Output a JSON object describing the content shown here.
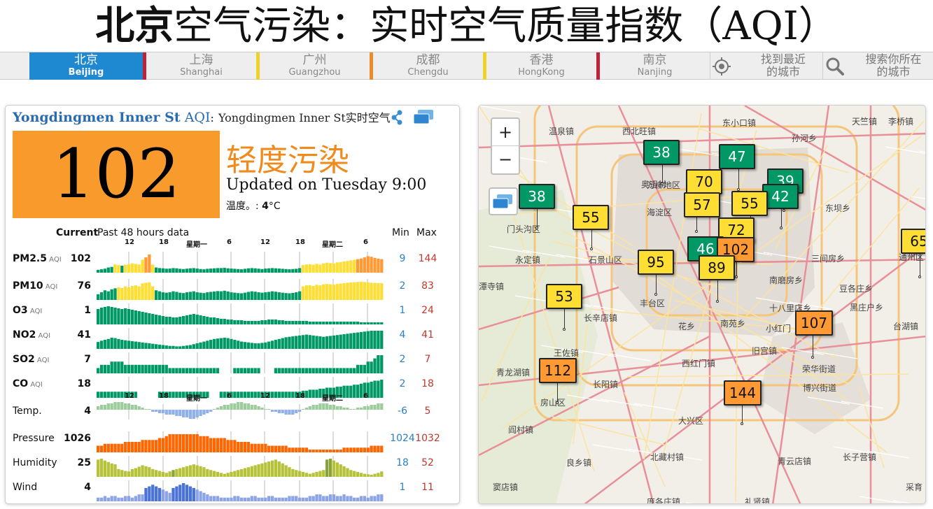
{
  "header": {
    "title_bold": "北京",
    "title_rest": "空气污染：实时空气质量指数（AQI）"
  },
  "nav": {
    "tabs": [
      {
        "zh": "北京",
        "en": "Beijing",
        "active": true
      },
      {
        "zh": "上海",
        "en": "Shanghai"
      },
      {
        "zh": "广州",
        "en": "Guangzhou"
      },
      {
        "zh": "成都",
        "en": "Chengdu"
      },
      {
        "zh": "香港",
        "en": "HongKong"
      },
      {
        "zh": "南京",
        "en": "Nanjing"
      }
    ],
    "separator_colors": [
      "#c0223b",
      "#ecd326",
      "#ec8b2c",
      "#ecd326",
      "#c0223b"
    ],
    "find_nearest_line1": "找到最近",
    "find_nearest_line2": "的城市",
    "search_line1": "搜索你所在",
    "search_line2": "的城市",
    "icons": [
      "locate-icon",
      "search-icon"
    ]
  },
  "station": {
    "name": "Yongdingmen Inner St",
    "aqi_label": "AQI",
    "colon": ":",
    "description": "Yongdingmen Inner St实时空气",
    "aqi": "102",
    "level": "轻度污染",
    "updated": "Updated on Tuesday 9:00",
    "temp_label": "温度。:",
    "temp_value": "4",
    "temp_unit": "°C",
    "aqi_color": "#f99b2c"
  },
  "table": {
    "current_header": "Current",
    "past_header": "Past 48 hours data",
    "min_header": "Min",
    "max_header": "Max",
    "time_ticks": [
      "12",
      "18",
      "星期一",
      "6",
      "12",
      "18",
      "星期二",
      "6"
    ],
    "rows": [
      {
        "name": "PM2.5",
        "sub": "AQI",
        "current": "102",
        "min": "9",
        "max": "144",
        "bold": true
      },
      {
        "name": "PM10",
        "sub": "AQI",
        "current": "76",
        "min": "2",
        "max": "83",
        "bold": true
      },
      {
        "name": "O3",
        "sub": "AQI",
        "current": "1",
        "min": "1",
        "max": "24",
        "bold": true
      },
      {
        "name": "NO2",
        "sub": "AQI",
        "current": "41",
        "min": "4",
        "max": "41",
        "bold": true
      },
      {
        "name": "SO2",
        "sub": "AQI",
        "current": "7",
        "min": "2",
        "max": "7",
        "bold": true
      },
      {
        "name": "CO",
        "sub": "AQI",
        "current": "18",
        "min": "2",
        "max": "18",
        "bold": true
      },
      {
        "name": "Temp.",
        "sub": "",
        "current": "4",
        "min": "-6",
        "max": "5",
        "bold": false
      },
      {
        "name": "Pressure",
        "sub": "",
        "current": "1026",
        "min": "1024",
        "max": "1032",
        "bold": false
      },
      {
        "name": "Humidity",
        "sub": "",
        "current": "25",
        "min": "18",
        "max": "52",
        "bold": false
      },
      {
        "name": "Wind",
        "sub": "",
        "current": "4",
        "min": "1",
        "max": "11",
        "bold": false
      }
    ]
  },
  "colors": {
    "good": "#009966",
    "moderate": "#ffde33",
    "usg": "#ff9933",
    "temp": "#8fb0e8",
    "temp_warm": "#9ccc9c",
    "pressure": "#ff6600",
    "humidity": "#b5c23a",
    "wind": "#8ba4e8",
    "nav_active": "#1e88d0"
  },
  "map": {
    "zoom_in": "+",
    "zoom_out": "−",
    "places": [
      "温泉镇",
      "西北旺镇",
      "东小口镇",
      "天竺镇",
      "李桥镇",
      "孙河乡",
      "万柳地区",
      "海淀区",
      "门头沟区",
      "东坝乡",
      "石景山区",
      "永定镇",
      "三间房乡",
      "潭寺镇",
      "丰台区",
      "南磨房乡",
      "豆各庄乡",
      "长辛店镇",
      "花乡",
      "南苑乡",
      "十八里店乡",
      "黑庄户乡",
      "台湖镇",
      "小红门",
      "旧宫镇",
      "王佐镇",
      "荣华街道",
      "青龙湖镇",
      "长阳镇",
      "西红门镇",
      "博兴街道",
      "房山区",
      "大兴区",
      "阎村镇",
      "北藏村镇",
      "青云店镇",
      "长子营镇",
      "良乡镇",
      "窦店镇",
      "庞各庄镇",
      "礼贤镇",
      "采育",
      "通州区",
      "奥运村"
    ],
    "markers": [
      {
        "v": "38",
        "c": "good"
      },
      {
        "v": "47",
        "c": "good"
      },
      {
        "v": "39",
        "c": "good"
      },
      {
        "v": "42",
        "c": "good"
      },
      {
        "v": "38",
        "c": "good"
      },
      {
        "v": "70",
        "c": "moderate"
      },
      {
        "v": "57",
        "c": "moderate"
      },
      {
        "v": "55",
        "c": "moderate"
      },
      {
        "v": "55",
        "c": "moderate"
      },
      {
        "v": "72",
        "c": "moderate"
      },
      {
        "v": "46",
        "c": "good"
      },
      {
        "v": "102",
        "c": "usg"
      },
      {
        "v": "95",
        "c": "moderate"
      },
      {
        "v": "89",
        "c": "moderate"
      },
      {
        "v": "53",
        "c": "moderate"
      },
      {
        "v": "107",
        "c": "usg"
      },
      {
        "v": "112",
        "c": "usg"
      },
      {
        "v": "144",
        "c": "usg"
      },
      {
        "v": "65",
        "c": "moderate"
      }
    ]
  },
  "chart_data": {
    "type": "bar",
    "title": "Past 48 hours data",
    "x_ticks": [
      "12",
      "18",
      "星期一",
      "6",
      "12",
      "18",
      "星期二",
      "6"
    ],
    "series": [
      {
        "name": "PM2.5",
        "values": [
          15,
          20,
          25,
          35,
          40,
          60,
          55,
          50,
          58,
          62,
          70,
          65,
          60,
          100,
          120,
          144,
          60,
          35,
          30,
          28,
          25,
          26,
          30,
          28,
          24,
          22,
          25,
          28,
          30,
          26,
          22,
          20,
          24,
          26,
          28,
          30,
          30,
          32,
          28,
          26,
          24,
          22,
          20,
          24,
          28,
          30,
          28,
          25,
          22,
          26,
          28,
          30,
          28,
          26,
          24,
          22,
          20,
          22,
          24,
          30,
          55,
          60,
          62,
          58,
          65,
          60,
          70,
          75,
          72,
          70,
          78,
          80,
          85,
          90,
          95,
          100,
          105,
          110,
          120,
          130,
          125,
          115,
          110,
          105
        ]
      },
      {
        "name": "PM10",
        "values": [
          20,
          30,
          40,
          35,
          45,
          50,
          55,
          52,
          60,
          55,
          62,
          65,
          60,
          75,
          78,
          80,
          60,
          40,
          35,
          30,
          28,
          30,
          35,
          32,
          28,
          26,
          30,
          32,
          35,
          30,
          28,
          26,
          30,
          32,
          34,
          36,
          35,
          38,
          34,
          30,
          28,
          26,
          25,
          28,
          32,
          35,
          33,
          30,
          28,
          30,
          32,
          35,
          33,
          30,
          28,
          26,
          25,
          27,
          30,
          35,
          60,
          65,
          66,
          62,
          68,
          65,
          70,
          72,
          70,
          68,
          72,
          74,
          76,
          78,
          80,
          81,
          82,
          83,
          82,
          80,
          78,
          77,
          76,
          76
        ]
      },
      {
        "name": "O3",
        "values": [
          20,
          22,
          23,
          24,
          23,
          22,
          21,
          20,
          21,
          20,
          19,
          18,
          17,
          16,
          15,
          14,
          13,
          12,
          11,
          10,
          9,
          9,
          8,
          8,
          9,
          10,
          11,
          12,
          13,
          12,
          11,
          10,
          9,
          8,
          8,
          7,
          6,
          6,
          5,
          5,
          4,
          4,
          4,
          3,
          3,
          3,
          3,
          3,
          4,
          4,
          5,
          5,
          5,
          4,
          4,
          3,
          3,
          3,
          3,
          3,
          3,
          3,
          2,
          2,
          2,
          2,
          2,
          2,
          2,
          2,
          2,
          2,
          2,
          2,
          2,
          2,
          2,
          1,
          1,
          1,
          1,
          1,
          1,
          1
        ]
      },
      {
        "name": "NO2",
        "values": [
          15,
          18,
          20,
          22,
          25,
          24,
          22,
          20,
          19,
          18,
          17,
          16,
          15,
          14,
          13,
          12,
          11,
          10,
          9,
          8,
          7,
          6,
          6,
          5,
          5,
          6,
          7,
          8,
          10,
          12,
          14,
          16,
          18,
          20,
          22,
          23,
          24,
          25,
          24,
          22,
          20,
          18,
          16,
          15,
          14,
          13,
          12,
          12,
          13,
          14,
          16,
          18,
          20,
          22,
          24,
          26,
          27,
          28,
          29,
          30,
          31,
          32,
          31,
          30,
          29,
          28,
          27,
          28,
          29,
          30,
          31,
          32,
          33,
          34,
          35,
          36,
          37,
          38,
          39,
          40,
          41,
          41,
          41,
          41
        ]
      },
      {
        "name": "SO2",
        "values": [
          3,
          4,
          4,
          4,
          5,
          5,
          5,
          5,
          4,
          4,
          4,
          4,
          4,
          4,
          4,
          4,
          4,
          4,
          4,
          4,
          4,
          3,
          3,
          3,
          3,
          3,
          3,
          3,
          3,
          3,
          3,
          3,
          3,
          3,
          3,
          3,
          0,
          0,
          0,
          0,
          3,
          3,
          3,
          3,
          3,
          3,
          3,
          3,
          0,
          0,
          0,
          0,
          3,
          3,
          3,
          3,
          3,
          3,
          3,
          3,
          3,
          3,
          3,
          3,
          3,
          3,
          3,
          3,
          3,
          3,
          3,
          3,
          3,
          3,
          3,
          3,
          4,
          4,
          4,
          5,
          5,
          6,
          7,
          7
        ]
      },
      {
        "name": "CO",
        "values": [
          6,
          6,
          6,
          6,
          6,
          6,
          6,
          6,
          6,
          6,
          6,
          6,
          0,
          0,
          0,
          0,
          0,
          0,
          6,
          6,
          6,
          6,
          6,
          6,
          6,
          6,
          6,
          6,
          6,
          6,
          6,
          6,
          6,
          0,
          0,
          0,
          6,
          6,
          6,
          6,
          6,
          6,
          6,
          6,
          6,
          6,
          6,
          6,
          6,
          6,
          6,
          6,
          6,
          6,
          6,
          6,
          6,
          6,
          6,
          6,
          7,
          7,
          8,
          8,
          8,
          9,
          9,
          10,
          10,
          10,
          11,
          11,
          12,
          12,
          12,
          13,
          13,
          14,
          15,
          15,
          16,
          17,
          17,
          18
        ]
      },
      {
        "name": "Temp.",
        "values": [
          2,
          3,
          3,
          4,
          4,
          5,
          5,
          5,
          4,
          4,
          3,
          3,
          2,
          1,
          0,
          0,
          -1,
          -1,
          -2,
          -2,
          -3,
          -3,
          -3,
          -4,
          -4,
          -5,
          -5,
          -6,
          -6,
          -5,
          -4,
          -3,
          -2,
          -1,
          0,
          1,
          2,
          3,
          3,
          4,
          4,
          5,
          5,
          4,
          4,
          3,
          3,
          2,
          1,
          0,
          0,
          -1,
          -1,
          -2,
          -2,
          -3,
          -3,
          -3,
          -2,
          -1,
          0,
          1,
          2,
          3,
          3,
          4,
          4,
          4,
          3,
          3,
          2,
          2,
          1,
          1,
          0,
          0,
          1,
          1,
          2,
          2,
          3,
          3,
          4,
          4
        ]
      },
      {
        "name": "Pressure",
        "values": [
          1026,
          1026,
          1027,
          1027,
          1027,
          1027,
          1027,
          1027,
          1028,
          1028,
          1028,
          1028,
          1028,
          1029,
          1029,
          1029,
          1029,
          1029,
          1030,
          1030,
          1031,
          1032,
          1032,
          1032,
          1032,
          1032,
          1032,
          1032,
          1032,
          1032,
          1031,
          1031,
          1031,
          1030,
          1030,
          1030,
          1030,
          1030,
          1029,
          1029,
          1029,
          1028,
          1028,
          1028,
          1028,
          1027,
          1027,
          1027,
          1027,
          1027,
          1026,
          1026,
          1026,
          1026,
          1026,
          1026,
          1025,
          1025,
          1025,
          1025,
          1025,
          1025,
          1024,
          1024,
          1024,
          1024,
          1024,
          1024,
          1024,
          1024,
          1024,
          1024,
          1025,
          1025,
          1025,
          1025,
          1025,
          1025,
          1025,
          1025,
          1026,
          1026,
          1026,
          1026
        ]
      },
      {
        "name": "Humidity",
        "values": [
          50,
          52,
          48,
          45,
          42,
          40,
          30,
          28,
          26,
          25,
          30,
          32,
          35,
          38,
          36,
          34,
          30,
          28,
          26,
          24,
          22,
          25,
          28,
          30,
          32,
          34,
          36,
          38,
          40,
          38,
          36,
          34,
          30,
          28,
          26,
          24,
          22,
          20,
          22,
          24,
          26,
          28,
          30,
          32,
          34,
          36,
          38,
          40,
          42,
          44,
          46,
          48,
          50,
          46,
          42,
          38,
          34,
          30,
          28,
          26,
          24,
          22,
          20,
          22,
          24,
          26,
          28,
          50,
          52,
          48,
          44,
          40,
          36,
          32,
          28,
          26,
          24,
          22,
          20,
          19,
          18,
          20,
          22,
          25
        ]
      },
      {
        "name": "Wind",
        "values": [
          2,
          2,
          3,
          2,
          3,
          3,
          2,
          2,
          3,
          3,
          2,
          3,
          4,
          4,
          8,
          9,
          10,
          9,
          8,
          7,
          6,
          5,
          8,
          9,
          10,
          11,
          10,
          9,
          8,
          7,
          6,
          5,
          4,
          3,
          3,
          3,
          2,
          2,
          2,
          2,
          3,
          3,
          2,
          2,
          2,
          3,
          3,
          2,
          2,
          2,
          3,
          3,
          2,
          2,
          2,
          2,
          3,
          3,
          3,
          2,
          2,
          2,
          3,
          3,
          4,
          4,
          3,
          3,
          4,
          4,
          3,
          3,
          4,
          3,
          3,
          2,
          2,
          3,
          3,
          2,
          3,
          3,
          4,
          4
        ]
      }
    ]
  }
}
